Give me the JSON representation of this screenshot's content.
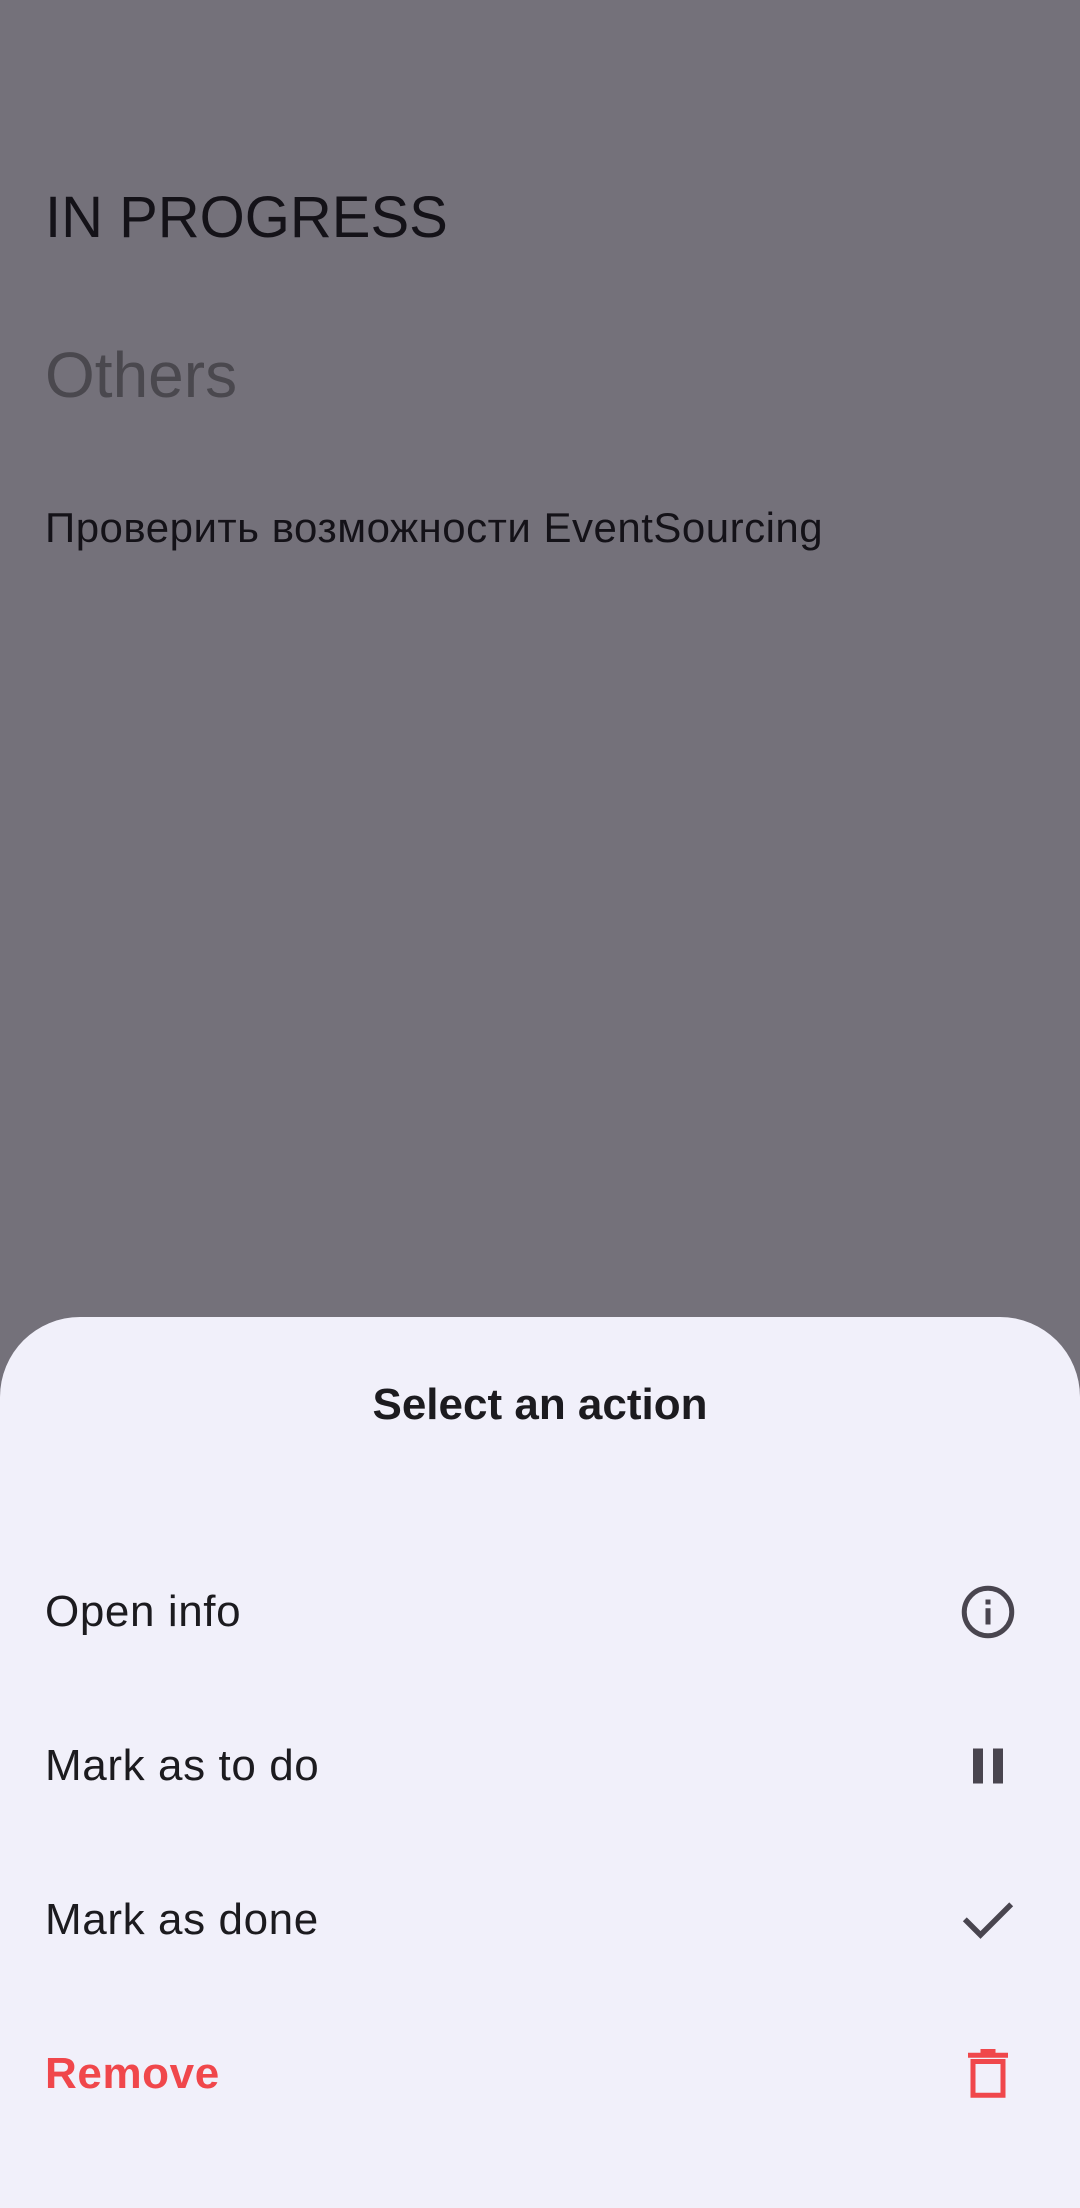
{
  "background": {
    "section_title": "IN PROGRESS",
    "group_title": "Others",
    "tasks": [
      {
        "title": "Проверить возможности EventSourcing"
      }
    ]
  },
  "sheet": {
    "title": "Select an action",
    "actions": [
      {
        "label": "Open info",
        "icon": "info-icon"
      },
      {
        "label": "Mark as to do",
        "icon": "pause-icon"
      },
      {
        "label": "Mark as done",
        "icon": "check-icon"
      },
      {
        "label": "Remove",
        "icon": "trash-icon",
        "color": "#F0474B"
      }
    ]
  },
  "colors": {
    "scrim": "#74717A",
    "sheet_background": "#F1F0FA",
    "text_primary": "#1C1B1F",
    "icon_default": "#49454F",
    "danger": "#F0474B"
  }
}
